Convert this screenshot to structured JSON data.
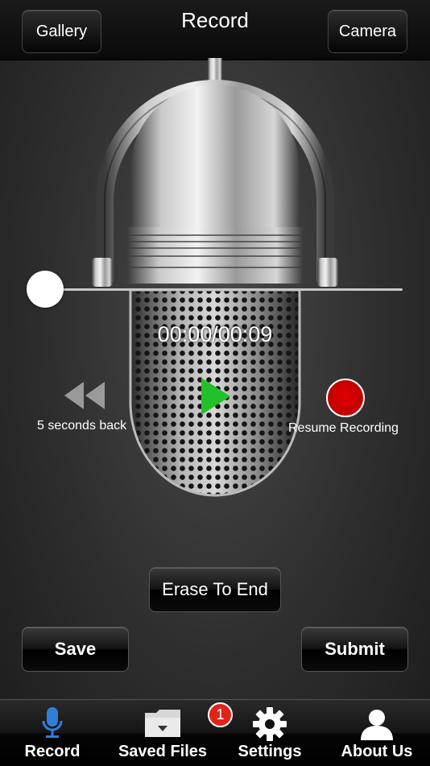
{
  "header": {
    "title": "Record",
    "gallery_label": "Gallery",
    "camera_label": "Camera"
  },
  "player": {
    "time": "00:00/00:09",
    "position_fraction": 0.0,
    "rewind_label": "5 seconds back",
    "resume_label": "Resume Recording"
  },
  "actions": {
    "erase_label": "Erase To End",
    "save_label": "Save",
    "submit_label": "Submit"
  },
  "tabbar": {
    "items": [
      {
        "label": "Record",
        "icon": "microphone-icon",
        "active": true
      },
      {
        "label": "Saved Files",
        "icon": "folder-icon",
        "badge": "1"
      },
      {
        "label": "Settings",
        "icon": "gear-icon"
      },
      {
        "label": "About Us",
        "icon": "person-icon"
      }
    ]
  },
  "colors": {
    "active_tab": "#2f7fd8",
    "record_button": "#d00000",
    "play_button": "#22c02a",
    "badge": "#e2231a"
  }
}
